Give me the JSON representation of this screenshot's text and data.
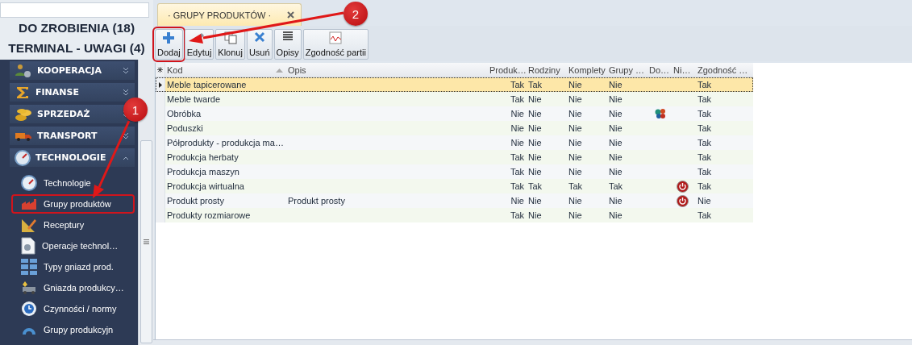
{
  "sidebar": {
    "counters": [
      "DO ZROBIENIA (18)",
      "TERMINAL - UWAGI (4)"
    ],
    "sections": [
      {
        "label": "KOOPERACJA",
        "expanded": false
      },
      {
        "label": "FINANSE",
        "expanded": false
      },
      {
        "label": "SPRZEDAŻ",
        "expanded": false
      },
      {
        "label": "TRANSPORT",
        "expanded": false
      },
      {
        "label": "TECHNOLOGIE",
        "expanded": true
      }
    ],
    "items": [
      {
        "label": "Technologie",
        "highlighted": false
      },
      {
        "label": "Grupy produktów",
        "highlighted": true
      },
      {
        "label": "Receptury",
        "highlighted": false
      },
      {
        "label": "Operacje technol…",
        "highlighted": false
      },
      {
        "label": "Typy gniazd prod.",
        "highlighted": false
      },
      {
        "label": "Gniazda produkcy…",
        "highlighted": false
      },
      {
        "label": "Czynności / normy",
        "highlighted": false
      },
      {
        "label": "Grupy produkcyjn",
        "highlighted": false
      }
    ]
  },
  "tabs": [
    {
      "label": "· GRUPY PRODUKTÓW ·",
      "selected": true
    }
  ],
  "toolbar": [
    {
      "label": "Dodaj",
      "highlighted": true
    },
    {
      "label": "Edytuj",
      "highlighted": false
    },
    {
      "label": "Klonuj",
      "highlighted": false
    },
    {
      "label": "Usuń",
      "highlighted": false
    },
    {
      "label": "Opisy",
      "highlighted": false
    },
    {
      "label": "Zgodność partii",
      "highlighted": false
    }
  ],
  "table": {
    "columns": [
      "Kod",
      "Opis",
      "Produk…",
      "Rodziny",
      "Komplety",
      "Grupy …",
      "Do…",
      "Ni…",
      "Zgodność …"
    ],
    "rows": [
      {
        "cells": [
          "Meble tapicerowane",
          "",
          "Tak",
          "Tak",
          "Nie",
          "Nie",
          "",
          "",
          "Tak"
        ],
        "selected": true,
        "linked": false,
        "inactive": false
      },
      {
        "cells": [
          "Meble twarde",
          "",
          "Tak",
          "Nie",
          "Nie",
          "Nie",
          "",
          "",
          "Tak"
        ],
        "selected": false,
        "linked": false,
        "inactive": false
      },
      {
        "cells": [
          "Obróbka",
          "",
          "Nie",
          "Nie",
          "Nie",
          "Nie",
          "",
          "",
          "Tak"
        ],
        "selected": false,
        "linked": true,
        "inactive": false
      },
      {
        "cells": [
          "Poduszki",
          "",
          "Nie",
          "Nie",
          "Nie",
          "Nie",
          "",
          "",
          "Tak"
        ],
        "selected": false,
        "linked": false,
        "inactive": false
      },
      {
        "cells": [
          "Półprodukty - produkcja ma…",
          "",
          "Nie",
          "Nie",
          "Nie",
          "Nie",
          "",
          "",
          "Tak"
        ],
        "selected": false,
        "linked": false,
        "inactive": false
      },
      {
        "cells": [
          "Produkcja herbaty",
          "",
          "Tak",
          "Nie",
          "Nie",
          "Nie",
          "",
          "",
          "Tak"
        ],
        "selected": false,
        "linked": false,
        "inactive": false
      },
      {
        "cells": [
          "Produkcja maszyn",
          "",
          "Tak",
          "Nie",
          "Nie",
          "Nie",
          "",
          "",
          "Tak"
        ],
        "selected": false,
        "linked": false,
        "inactive": false
      },
      {
        "cells": [
          "Produkcja wirtualna",
          "",
          "Tak",
          "Tak",
          "Tak",
          "Tak",
          "",
          "",
          "Tak"
        ],
        "selected": false,
        "linked": false,
        "inactive": true
      },
      {
        "cells": [
          "Produkt prosty",
          "Produkt prosty",
          "Nie",
          "Nie",
          "Nie",
          "Nie",
          "",
          "",
          "Nie"
        ],
        "selected": false,
        "linked": false,
        "inactive": true
      },
      {
        "cells": [
          "Produkty rozmiarowe",
          "",
          "Tak",
          "Nie",
          "Nie",
          "Nie",
          "",
          "",
          "Tak"
        ],
        "selected": false,
        "linked": false,
        "inactive": false
      }
    ]
  },
  "callouts": [
    "1",
    "2"
  ]
}
